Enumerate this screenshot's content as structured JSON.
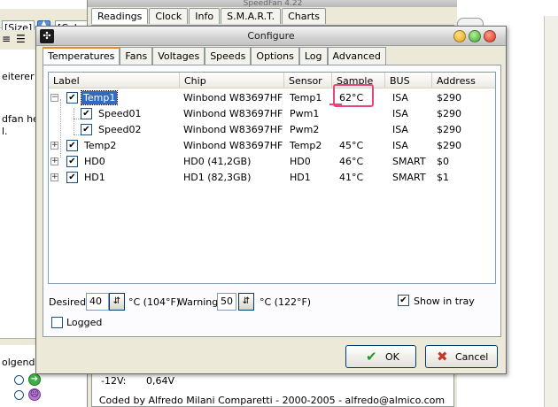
{
  "background": {
    "size_box": "[Size]",
    "color_box": "[Colo",
    "text_lines": [
      "eiterer l",
      "dfan he",
      "l.",
      "olgende"
    ],
    "speedfan_title": "SpeedFan 4.22",
    "speedfan_tabs": [
      "Readings",
      "Clock",
      "Info",
      "S.M.A.R.T.",
      "Charts"
    ],
    "voltage_label": "-12V:",
    "voltage_value": "0,64V",
    "credit": "Coded by Alfredo Milani Comparetti - 2000-2005 - alfredo@almico.com"
  },
  "dialog": {
    "title": "Configure",
    "tabs": [
      "Temperatures",
      "Fans",
      "Voltages",
      "Speeds",
      "Options",
      "Log",
      "Advanced"
    ],
    "active_tab": "Temperatures",
    "columns": [
      "Label",
      "Chip",
      "Sensor",
      "Sample",
      "BUS",
      "Address"
    ],
    "rows": [
      {
        "expander": "−",
        "checked": true,
        "label": "Temp1",
        "chip": "Winbond W83697HF",
        "sensor": "Temp1",
        "sample": "62°C",
        "bus": "ISA",
        "address": "$290",
        "selected": true,
        "indent": 0
      },
      {
        "expander": "",
        "checked": true,
        "label": "Speed01",
        "chip": "Winbond W83697HF",
        "sensor": "Pwm1",
        "sample": "",
        "bus": "ISA",
        "address": "$290",
        "selected": false,
        "indent": 1
      },
      {
        "expander": "",
        "checked": true,
        "label": "Speed02",
        "chip": "Winbond W83697HF",
        "sensor": "Pwm2",
        "sample": "",
        "bus": "ISA",
        "address": "$290",
        "selected": false,
        "indent": 1
      },
      {
        "expander": "+",
        "checked": true,
        "label": "Temp2",
        "chip": "Winbond W83697HF",
        "sensor": "Temp2",
        "sample": "45°C",
        "bus": "ISA",
        "address": "$290",
        "selected": false,
        "indent": 0
      },
      {
        "expander": "+",
        "checked": true,
        "label": "HD0",
        "chip": "HD0 (41,2GB)",
        "sensor": "HD0",
        "sample": "46°C",
        "bus": "SMART",
        "address": "$0",
        "selected": false,
        "indent": 0
      },
      {
        "expander": "+",
        "checked": true,
        "label": "HD1",
        "chip": "HD1 (82,3GB)",
        "sensor": "HD1",
        "sample": "41°C",
        "bus": "SMART",
        "address": "$1",
        "selected": false,
        "indent": 0
      }
    ],
    "desired_label": "Desired",
    "desired_value": "40",
    "desired_unit": "°C (104°F)",
    "warning_label": "Warning",
    "warning_value": "50",
    "warning_unit": "°C (122°F)",
    "show_in_tray_label": "Show in tray",
    "show_in_tray_checked": true,
    "logged_label": "Logged",
    "ok_label": "OK",
    "cancel_label": "Cancel"
  },
  "colors": {
    "selection": "#316ac5",
    "annotation": "#e8457a",
    "ok_check": "#1f9a1f",
    "cancel_x": "#c0392b"
  }
}
